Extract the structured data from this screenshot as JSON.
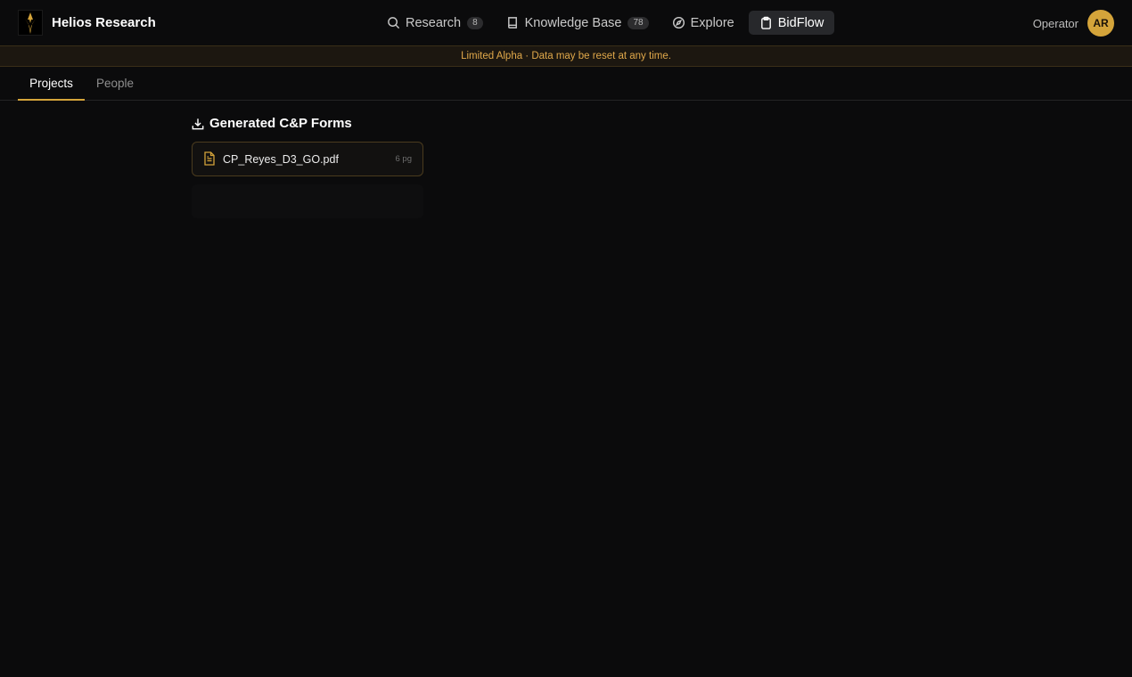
{
  "app": {
    "title": "Helios Research"
  },
  "nav": {
    "items": [
      {
        "label": "Research",
        "badge": "8",
        "icon": "search-icon"
      },
      {
        "label": "Knowledge Base",
        "badge": "78",
        "icon": "book-icon"
      },
      {
        "label": "Explore",
        "icon": "compass-icon"
      },
      {
        "label": "BidFlow",
        "icon": "clipboard-icon",
        "active": true
      }
    ]
  },
  "user": {
    "role": "Operator",
    "initials": "AR"
  },
  "banner": {
    "text": "Limited Alpha · Data may be reset at any time."
  },
  "tabs": [
    {
      "label": "Projects",
      "active": true
    },
    {
      "label": "People",
      "active": false
    }
  ],
  "section": {
    "title": "Generated C&P Forms",
    "icon": "download-icon"
  },
  "files": [
    {
      "name": "CP_Reyes_D3_GO.pdf",
      "pages": "6 pg",
      "icon": "file-text-icon"
    }
  ],
  "colors": {
    "accent": "#d4a43a",
    "banner_text": "#e0a84a",
    "background": "#0b0b0c"
  }
}
